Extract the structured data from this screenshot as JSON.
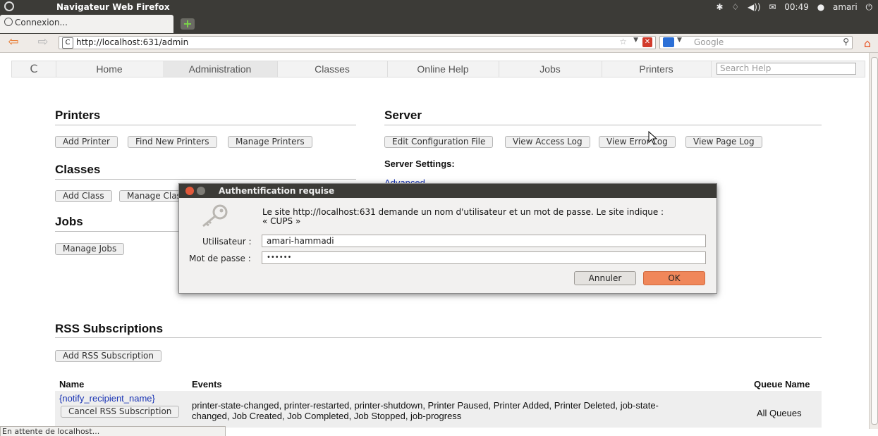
{
  "system_bar": {
    "app_title": "Navigateur Web Firefox",
    "time": "00:49",
    "user": "amari"
  },
  "tab": {
    "label": "Connexion..."
  },
  "navbar": {
    "url": "http://localhost:631/admin",
    "search_placeholder": "Google"
  },
  "cups_nav": {
    "items": [
      "Home",
      "Administration",
      "Classes",
      "Online Help",
      "Jobs",
      "Printers"
    ],
    "active": "Administration",
    "search_placeholder": "Search Help"
  },
  "sections": {
    "printers": {
      "title": "Printers",
      "buttons": [
        "Add Printer",
        "Find New Printers",
        "Manage Printers"
      ]
    },
    "classes": {
      "title": "Classes",
      "buttons": [
        "Add Class",
        "Manage Classes"
      ]
    },
    "jobs": {
      "title": "Jobs",
      "buttons": [
        "Manage Jobs"
      ]
    },
    "server": {
      "title": "Server",
      "buttons": [
        "Edit Configuration File",
        "View Access Log",
        "View Error Log",
        "View Page Log"
      ],
      "settings_label": "Server Settings:",
      "advanced_link": "Advanced"
    },
    "rss": {
      "title": "RSS Subscriptions",
      "add_button": "Add RSS Subscription",
      "columns": [
        "Name",
        "Events",
        "Queue Name"
      ],
      "rows": [
        {
          "name": "{notify_recipient_name}",
          "cancel_button": "Cancel RSS Subscription",
          "events_line1": "printer-state-changed, printer-restarted, printer-shutdown, Printer Paused, Printer Added, Printer Deleted, job-state-",
          "events_line2": "changed, Job Created, Job Completed, Job Stopped, job-progress",
          "queue": "All Queues"
        }
      ]
    }
  },
  "dialog": {
    "title": "Authentification requise",
    "message_line1": "Le site http://localhost:631 demande un nom d'utilisateur et un mot de passe. Le site indique :",
    "message_line2": "« CUPS »",
    "username_label": "Utilisateur :",
    "username_value": "amari-hammadi",
    "password_label": "Mot de passe :",
    "password_value": "••••••",
    "cancel_label": "Annuler",
    "ok_label": "OK"
  },
  "status_bar": {
    "text": "En attente de localhost..."
  }
}
